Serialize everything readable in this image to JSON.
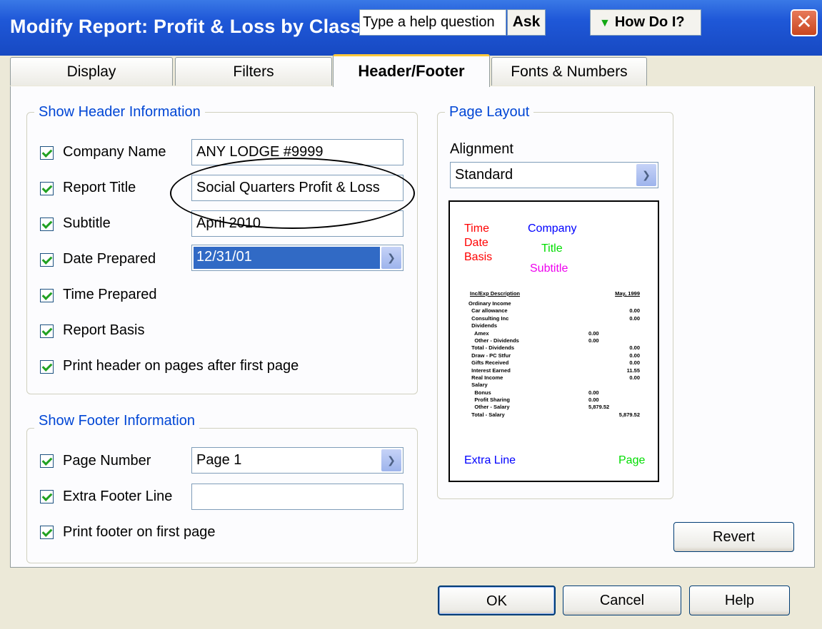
{
  "window": {
    "title": "Modify Report: Profit & Loss by Class",
    "help_placeholder": "Type a help question",
    "ask_label": "Ask",
    "howdoi_label": "How Do I?",
    "close_glyph": "✕"
  },
  "tabs": [
    {
      "label": "Display",
      "active": false
    },
    {
      "label": "Filters",
      "active": false
    },
    {
      "label": "Header/Footer",
      "active": true
    },
    {
      "label": "Fonts & Numbers",
      "active": false
    }
  ],
  "header_group": {
    "label": "Show Header Information",
    "company_name": {
      "label": "Company Name",
      "checked": true,
      "value": "ANY LODGE #9999"
    },
    "report_title": {
      "label": "Report Title",
      "checked": true,
      "value": "Social Quarters Profit & Loss"
    },
    "subtitle": {
      "label": "Subtitle",
      "checked": true,
      "value": "April 2010"
    },
    "date_prepared": {
      "label": "Date Prepared",
      "checked": true,
      "value": "12/31/01"
    },
    "time_prepared": {
      "label": "Time Prepared",
      "checked": true
    },
    "report_basis": {
      "label": "Report Basis",
      "checked": true
    },
    "print_header": {
      "label": "Print header on pages after first page",
      "checked": true
    }
  },
  "footer_group": {
    "label": "Show Footer Information",
    "page_number": {
      "label": "Page Number",
      "checked": true,
      "value": "Page 1"
    },
    "extra_footer": {
      "label": "Extra Footer Line",
      "checked": true,
      "value": ""
    },
    "print_footer": {
      "label": "Print footer on first page",
      "checked": true
    }
  },
  "layout_group": {
    "label": "Page Layout",
    "alignment_label": "Alignment",
    "alignment_value": "Standard",
    "preview": {
      "time": "Time",
      "date": "Date",
      "basis": "Basis",
      "company": "Company",
      "title": "Title",
      "subtitle": "Subtitle",
      "extra_line": "Extra Line",
      "page": "Page",
      "col_header": "Inc/Exp Description",
      "col_date": "May, 1999",
      "rows": [
        {
          "label": "Ordinary Income",
          "sub": "",
          "value": ""
        },
        {
          "label": "  Car allowance",
          "sub": "",
          "value": "0.00"
        },
        {
          "label": "  Consulting Inc",
          "sub": "",
          "value": "0.00"
        },
        {
          "label": "  Dividends",
          "sub": "",
          "value": ""
        },
        {
          "label": "    Amex",
          "sub": "0.00",
          "value": ""
        },
        {
          "label": "    Other - Dividends",
          "sub": "0.00",
          "value": ""
        },
        {
          "label": "  Total - Dividends",
          "sub": "",
          "value": "0.00"
        },
        {
          "label": "  Draw - PC Stfur",
          "sub": "",
          "value": "0.00"
        },
        {
          "label": "  Gifts Received",
          "sub": "",
          "value": "0.00"
        },
        {
          "label": "  Interest Earned",
          "sub": "",
          "value": "11.55"
        },
        {
          "label": "  Real Income",
          "sub": "",
          "value": "0.00"
        },
        {
          "label": "  Salary",
          "sub": "",
          "value": ""
        },
        {
          "label": "    Bonus",
          "sub": "0.00",
          "value": ""
        },
        {
          "label": "    Profit Sharing",
          "sub": "0.00",
          "value": ""
        },
        {
          "label": "    Other - Salary",
          "sub": "5,879.52",
          "value": ""
        },
        {
          "label": "  Total - Salary",
          "sub": "",
          "value": "5,879.52"
        }
      ]
    }
  },
  "buttons": {
    "revert": "Revert",
    "ok": "OK",
    "cancel": "Cancel",
    "help": "Help"
  },
  "colors": {
    "title_bar": "#1f58d8",
    "group_label": "#0046d5",
    "preview_red": "#ff0000",
    "preview_blue": "#0000ff",
    "preview_green": "#00dd00",
    "preview_magenta": "#ee00ee",
    "selection": "#316ac5"
  }
}
